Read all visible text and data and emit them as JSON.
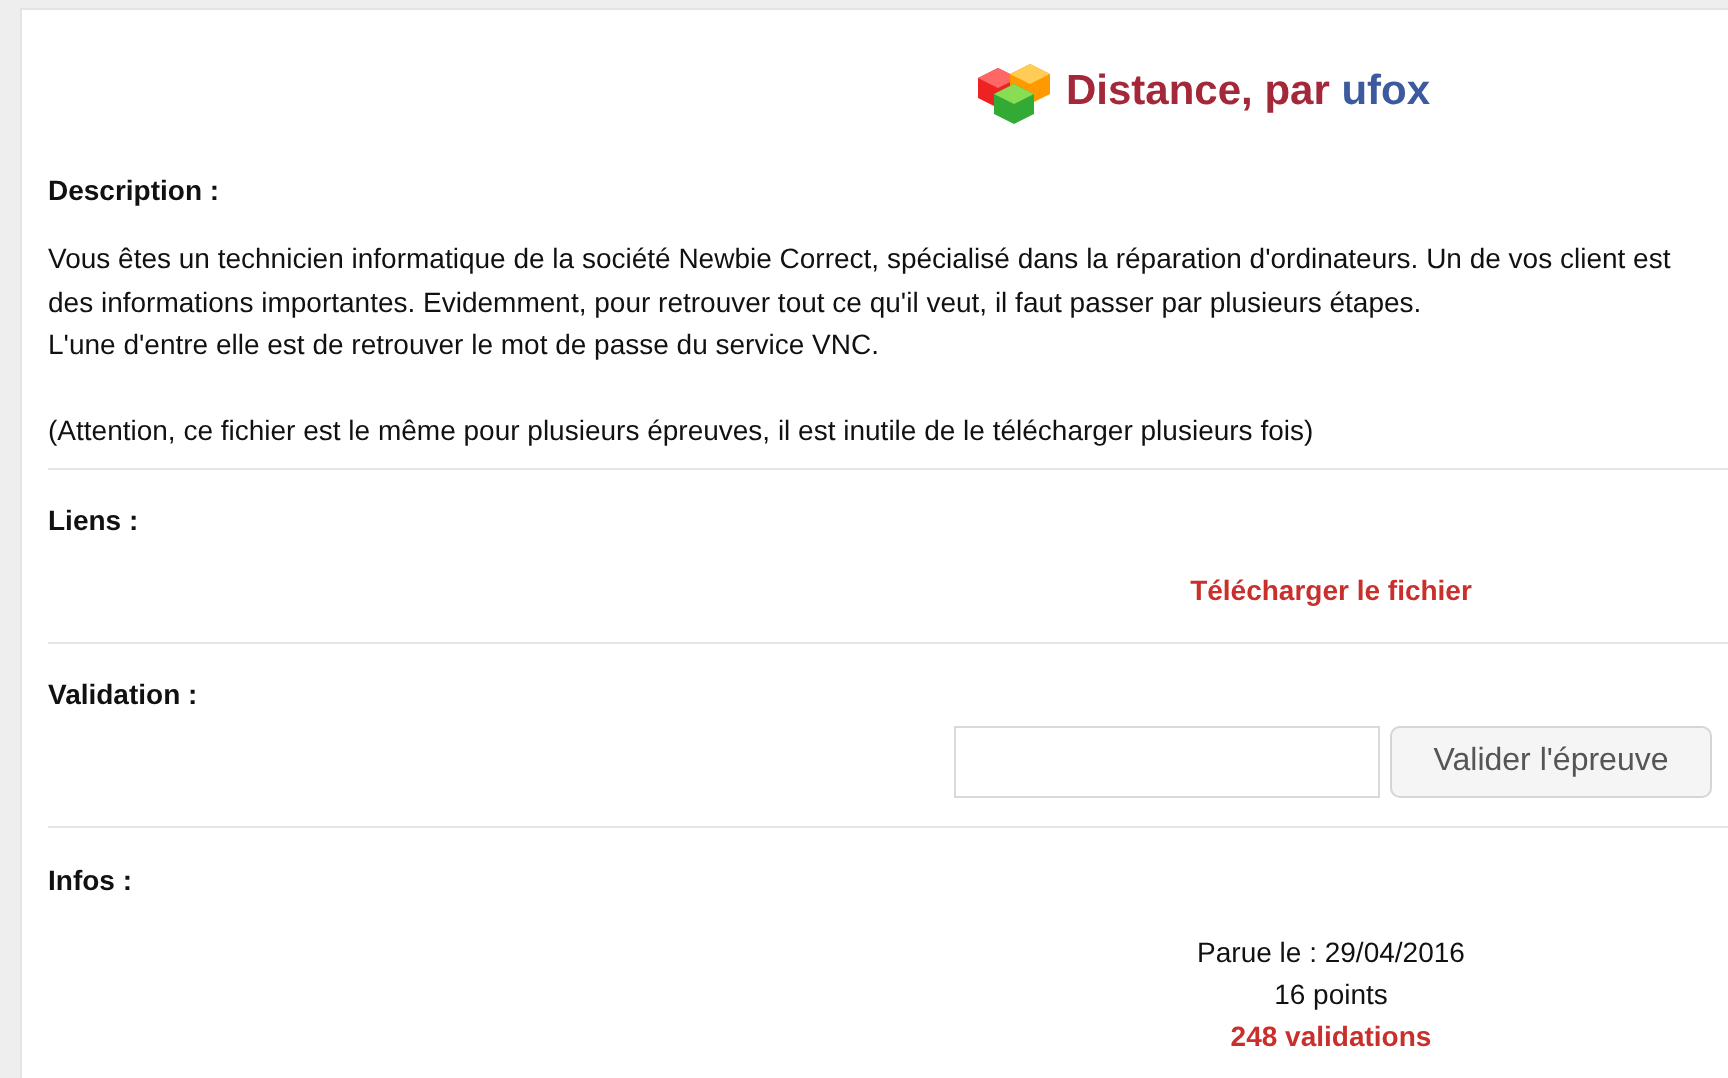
{
  "header": {
    "title": "Distance, par",
    "author": "ufox"
  },
  "description": {
    "heading": "Description :",
    "lines": [
      "Vous êtes un technicien informatique de la société Newbie Correct, spécialisé dans la réparation d'ordinateurs. Un de vos client est",
      "des informations importantes. Evidemment, pour retrouver tout ce qu'il veut, il faut passer par plusieurs étapes.",
      "L'une d'entre elle est de retrouver le mot de passe du service VNC."
    ],
    "note": "(Attention, ce fichier est le même pour plusieurs épreuves, il est inutile de le télécharger plusieurs fois)"
  },
  "links": {
    "heading": "Liens :",
    "download": "Télécharger le fichier"
  },
  "validation": {
    "heading": "Validation :",
    "button": "Valider l'épreuve"
  },
  "infos": {
    "heading": "Infos :",
    "published": "Parue le : 29/04/2016",
    "points": "16 points",
    "validations": "248 validations"
  }
}
